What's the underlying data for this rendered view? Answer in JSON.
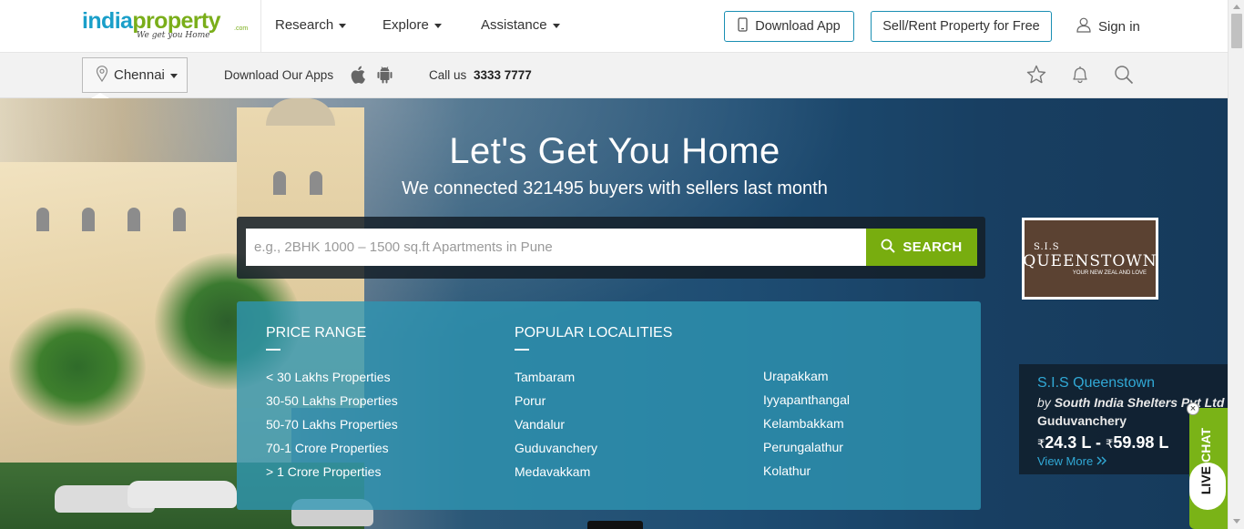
{
  "header": {
    "logo_primary": "india",
    "logo_secondary": "property",
    "logo_com": ".com",
    "logo_tagline": "We get you Home",
    "nav": [
      {
        "label": "Research"
      },
      {
        "label": "Explore"
      },
      {
        "label": "Assistance"
      }
    ],
    "download_app": "Download App",
    "sell_rent": "Sell/Rent Property for Free",
    "sign_in": "Sign in"
  },
  "subbar": {
    "city": "Chennai",
    "download_apps": "Download Our Apps",
    "call_label": "Call us",
    "call_number": "3333 7777",
    "icons": [
      "apple-icon",
      "android-icon",
      "star-icon",
      "bell-icon",
      "search-icon"
    ]
  },
  "hero": {
    "title": "Let's Get You Home",
    "subtitle": "We connected 321495 buyers with sellers last month",
    "search": {
      "placeholder": "e.g., 2BHK 1000 – 1500 sq.ft Apartments in Pune",
      "button": "SEARCH"
    }
  },
  "panel": {
    "price_heading": "PRICE RANGE",
    "price_links": [
      "< 30 Lakhs Properties",
      "30-50 Lakhs Properties",
      "50-70 Lakhs Properties",
      "70-1 Crore Properties",
      "> 1 Crore Properties"
    ],
    "localities_heading": "POPULAR LOCALITIES",
    "localities_col1": [
      "Tambaram",
      "Porur",
      "Vandalur",
      "Guduvanchery",
      "Medavakkam"
    ],
    "localities_col2": [
      "Urapakkam",
      "Iyyapanthangal",
      "Kelambakkam",
      "Perungalathur",
      "Kolathur"
    ]
  },
  "ad": {
    "line1": "S.I.S",
    "line2": "QUEENSTOWN",
    "line3": "YOUR NEW ZEAL AND LOVE"
  },
  "promo": {
    "title": "S.I.S Queenstown",
    "by": "by",
    "developer": "South India Shelters Pvt Ltd",
    "location": "Guduvanchery",
    "currency": "₹",
    "price_from": "24.3 L",
    "price_to": "59.98 L",
    "separator": "-",
    "view_more": "View More"
  },
  "livechat": {
    "live": "LIVE",
    "chat": "CHAT",
    "close": "×"
  },
  "colors": {
    "brand_blue": "#1a9fc9",
    "brand_green": "#7aae1a",
    "search_green": "#78ad0f",
    "panel_teal": "#2e96b4"
  }
}
